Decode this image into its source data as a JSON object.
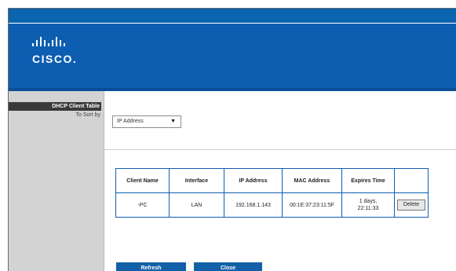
{
  "logo": {
    "wordmark": "CISCO."
  },
  "sidebar": {
    "title": "DHCP Client Table",
    "sort_label": "To Sort by"
  },
  "sort_select": {
    "value": "IP Address"
  },
  "table": {
    "headers": [
      "Client Name",
      "Interface",
      "IP Address",
      "MAC Address",
      "Expires Time",
      ""
    ],
    "rows": [
      {
        "client_name": "-PC",
        "interface": "LAN",
        "ip_address": "192.168.1.143",
        "mac_address": "00:1E:37:23:11:5F",
        "expires_line1": "1 days,",
        "expires_line2": "22:11:33",
        "delete_label": "Delete"
      }
    ]
  },
  "buttons": {
    "refresh": "Refresh",
    "close": "Close"
  },
  "colors": {
    "header": "#0d5eb1",
    "table_border": "#0f5fb2",
    "button": "#1260a8",
    "sidebar": "#d3d3d3"
  }
}
